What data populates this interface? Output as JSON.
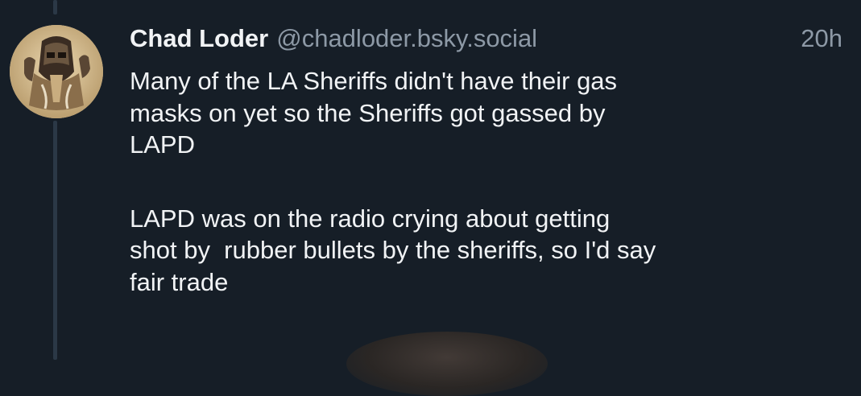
{
  "post": {
    "author_name": "Chad Loder",
    "author_handle": "@chadloder.bsky.social",
    "timestamp": "20h",
    "paragraphs": [
      {
        "lines": [
          "Many of the LA Sheriffs didn't have their gas",
          "masks on yet so the Sheriffs got gassed by",
          "LAPD"
        ]
      },
      {
        "lines": [
          "LAPD was on the radio crying about getting",
          "shot by  rubber bullets by the sheriffs, so I'd say",
          "fair trade"
        ]
      }
    ]
  },
  "colors": {
    "background": "#161e27",
    "thread_line": "#2b3846",
    "text_primary": "#f1f3f5",
    "text_secondary": "#8d99a6"
  }
}
